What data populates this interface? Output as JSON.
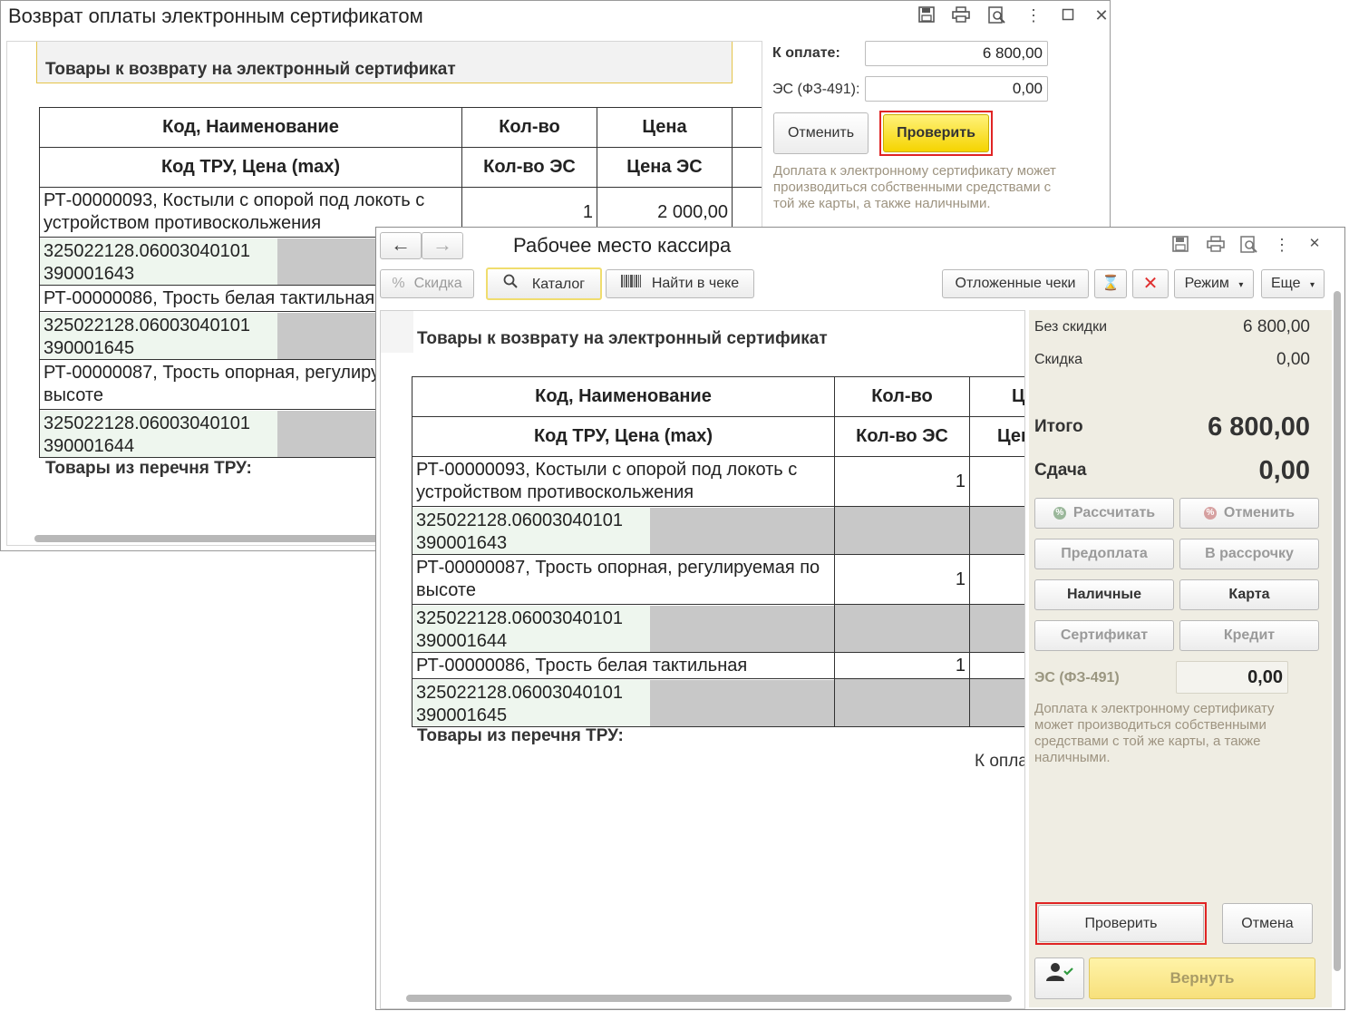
{
  "back_window": {
    "title": "Возврат оплаты электронным сертификатом",
    "title_icons": [
      "save-icon",
      "print-icon",
      "preview-icon",
      "more-icon",
      "maximize-icon",
      "close-icon"
    ],
    "section_title": "Товары к возврату на электронный сертификат",
    "table": {
      "header1": [
        "Код, Наименование",
        "Кол-во",
        "Цена"
      ],
      "header2": [
        "Код ТРУ, Цена (max)",
        "Кол-во ЭС",
        "Цена ЭС"
      ],
      "rows": [
        {
          "name": "РТ-00000093, Костыли с опорой под локоть с устройством противоскольжения",
          "qty": "1",
          "price": "2 000,00",
          "code1": "325022128.06003040101",
          "code2": "390001643"
        },
        {
          "name": "РТ-00000086, Трость белая тактильная",
          "qty": "",
          "price": "",
          "code1": "325022128.06003040101",
          "code2": "390001645"
        },
        {
          "name": "РТ-00000087, Трость опорная, регулируемая по высоте",
          "qty": "",
          "price": "",
          "code1": "325022128.06003040101",
          "code2": "390001644"
        }
      ]
    },
    "footer_title": "Товары из перечня ТРУ:",
    "right": {
      "to_pay_label": "К оплате:",
      "to_pay_value": "6 800,00",
      "es_label": "ЭС (ФЗ-491):",
      "es_value": "0,00",
      "cancel_label": "Отменить",
      "check_label": "Проверить",
      "hint": "Доплата к электронному сертификату может производиться собственными средствами с той же карты, а также наличными."
    }
  },
  "front_window": {
    "title": "Рабочее место кассира",
    "nav": {
      "back": "←",
      "forward": "→"
    },
    "title_icons": [
      "save-icon",
      "print-icon",
      "preview-icon",
      "more-icon",
      "close-icon"
    ],
    "toolbar": {
      "discount": "Скидка",
      "catalog": "Каталог",
      "find_in_receipt": "Найти в чеке",
      "deferred": "Отложенные чеки",
      "mode": "Режим",
      "more": "Еще"
    },
    "section_title": "Товары к возврату на электронный сертификат",
    "table": {
      "header1": [
        "Код, Наименование",
        "Кол-во",
        "Ц"
      ],
      "header2": [
        "Код ТРУ, Цена (max)",
        "Кол-во ЭС",
        "Цен"
      ],
      "rows": [
        {
          "name": "РТ-00000093, Костыли с опорой под локоть с устройством противоскольжения",
          "qty": "1",
          "code1": "325022128.06003040101",
          "code2": "390001643"
        },
        {
          "name": "РТ-00000087, Трость опорная, регулируемая по высоте",
          "qty": "1",
          "code1": "325022128.06003040101",
          "code2": "390001644"
        },
        {
          "name": "РТ-00000086, Трость белая тактильная",
          "qty": "1",
          "code1": "325022128.06003040101",
          "code2": "390001645"
        }
      ]
    },
    "footer_title": "Товары из перечня ТРУ:",
    "footer_pay_partial": "К опла",
    "side": {
      "no_discount_label": "Без скидки",
      "no_discount_value": "6 800,00",
      "discount_label": "Скидка",
      "discount_value": "0,00",
      "total_label": "Итого",
      "total_value": "6 800,00",
      "change_label": "Сдача",
      "change_value": "0,00",
      "calc": "Рассчитать",
      "cancel": "Отменить",
      "prepay": "Предоплата",
      "installments": "В рассрочку",
      "cash": "Наличные",
      "card": "Карта",
      "certificate": "Сертификат",
      "credit": "Кредит",
      "es_label": "ЭС (ФЗ-491)",
      "es_value": "0,00",
      "hint": "Доплата к электронному сертификату может производиться собственными средствами с той же карты, а также наличными.",
      "check": "Проверить",
      "cancel2": "Отмена",
      "return": "Вернуть"
    }
  }
}
